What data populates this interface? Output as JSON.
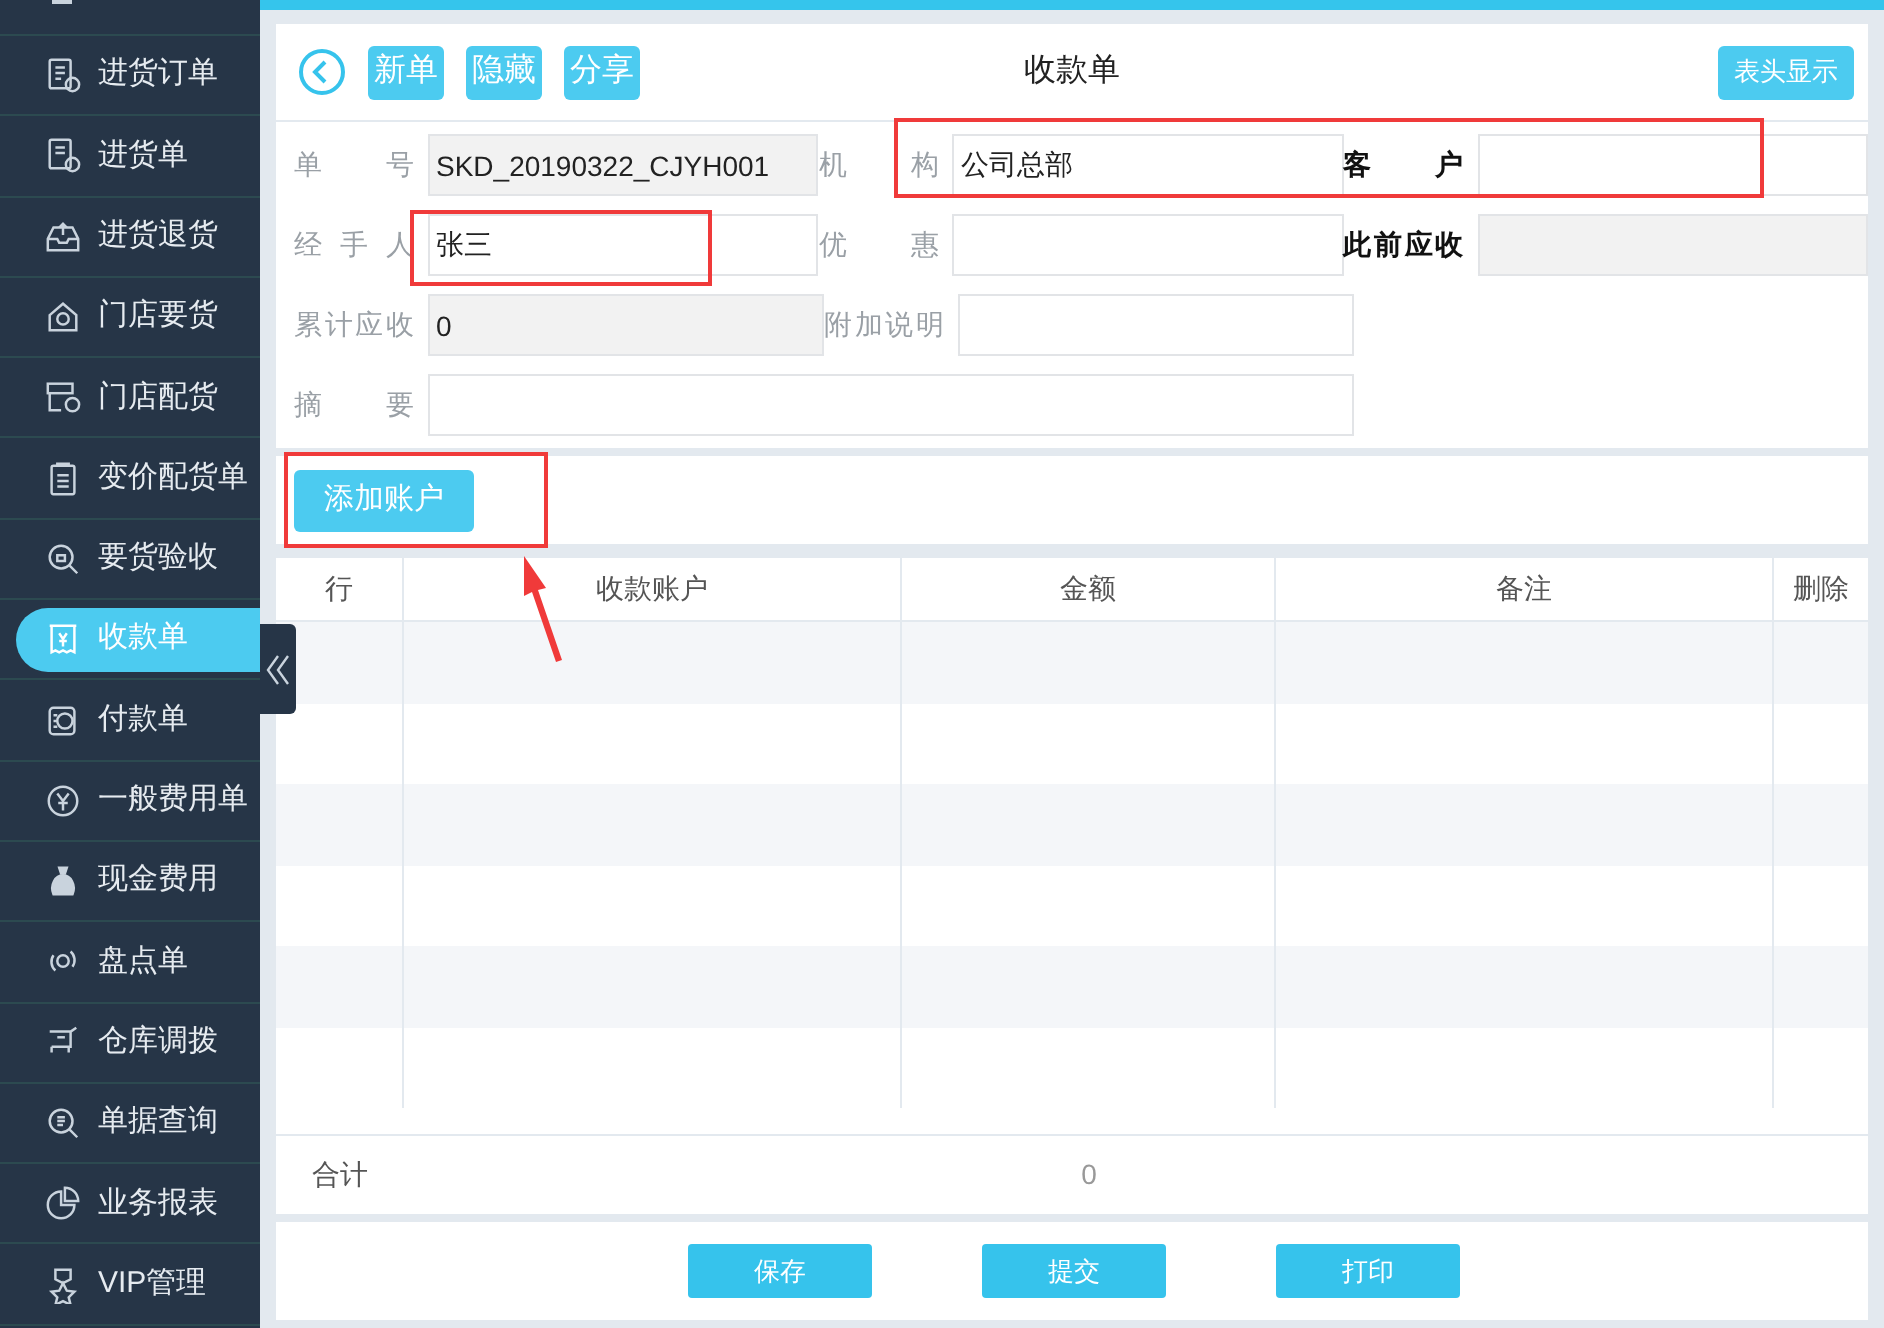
{
  "sidebar": {
    "items": [
      {
        "label": "进货订单",
        "selected": false
      },
      {
        "label": "进货单",
        "selected": false
      },
      {
        "label": "进货退货",
        "selected": false
      },
      {
        "label": "门店要货",
        "selected": false
      },
      {
        "label": "门店配货",
        "selected": false
      },
      {
        "label": "变价配货单",
        "selected": false
      },
      {
        "label": "要货验收",
        "selected": false
      },
      {
        "label": "收款单",
        "selected": true
      },
      {
        "label": "付款单",
        "selected": false
      },
      {
        "label": "一般费用单",
        "selected": false
      },
      {
        "label": "现金费用",
        "selected": false
      },
      {
        "label": "盘点单",
        "selected": false
      },
      {
        "label": "仓库调拨",
        "selected": false
      },
      {
        "label": "单据查询",
        "selected": false
      },
      {
        "label": "业务报表",
        "selected": false
      },
      {
        "label": "VIP管理",
        "selected": false
      }
    ]
  },
  "toolbar": {
    "buttons": [
      "新单",
      "隐藏",
      "分享"
    ],
    "title": "收款单",
    "right_button": "表头显示"
  },
  "form": {
    "rows": [
      [
        {
          "label": "单 号",
          "value": "SKD_20190322_CJYH001",
          "disabled": true,
          "emphasized": false
        },
        {
          "label": "机 构",
          "value": "公司总部",
          "disabled": false,
          "emphasized": false
        },
        {
          "label": "客 户",
          "disabled": false,
          "emphasized": true
        }
      ],
      [
        {
          "label": "经 手 人",
          "value": "张三",
          "disabled": false,
          "emphasized": false
        },
        {
          "label": "优 惠",
          "disabled": false,
          "emphasized": false
        },
        {
          "label": "此前应收",
          "disabled": true,
          "emphasized": true
        }
      ],
      [
        {
          "label": "累计应收",
          "value": "0",
          "disabled": true,
          "emphasized": false
        },
        {
          "label": "附加说明",
          "disabled": false,
          "emphasized": false
        }
      ],
      [
        {
          "label": "摘 要",
          "disabled": false,
          "emphasized": false,
          "wide": true
        }
      ]
    ]
  },
  "add_button": "添加账户",
  "table": {
    "columns": [
      "行",
      "收款账户",
      "金额",
      "备注",
      "删除"
    ],
    "total": {
      "label": "合计",
      "amount": "0"
    }
  },
  "footer": {
    "buttons": [
      "保存",
      "提交",
      "打印"
    ]
  }
}
